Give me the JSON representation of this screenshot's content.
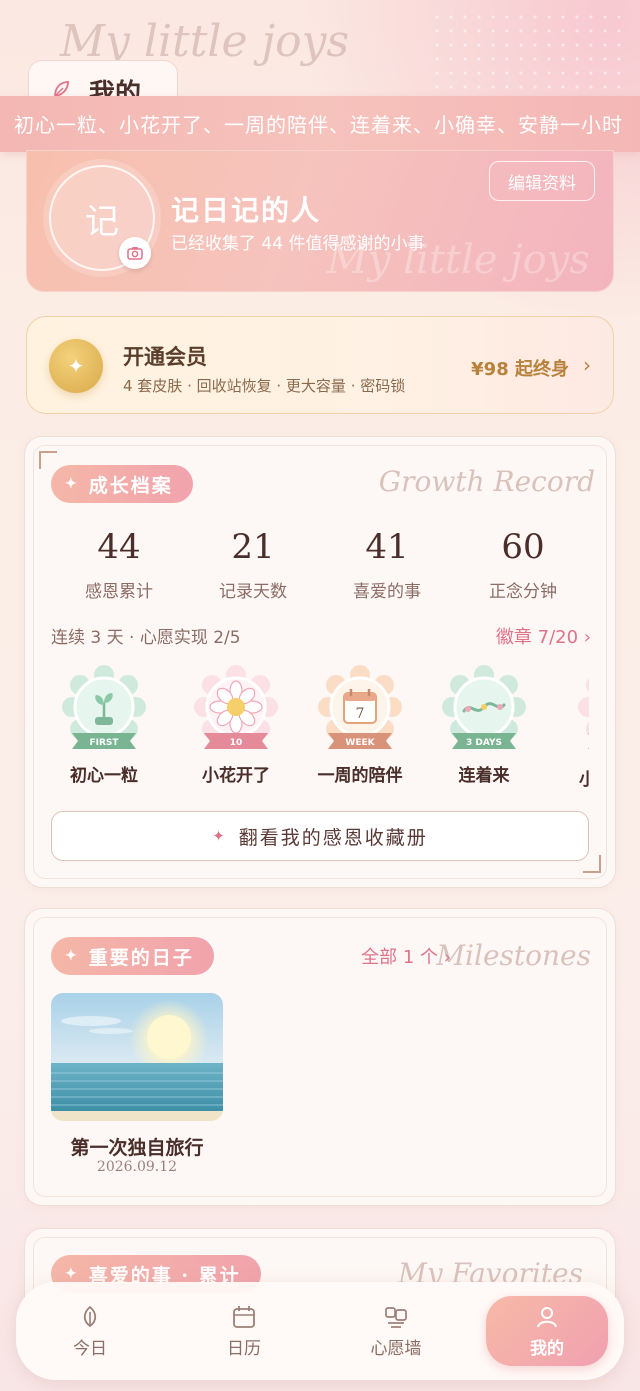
{
  "header": {
    "script": "My little joys",
    "title": "我的"
  },
  "marquee": {
    "text": "初心一粒、小花开了、一周的陪伴、连着来、小确幸、安静一小时"
  },
  "profile": {
    "avatar_char": "记",
    "name": "记日记的人",
    "subtitle": "已经收集了 44 件值得感谢的小事",
    "edit_label": "编辑资料",
    "script": "My little joys"
  },
  "vip": {
    "title": "开通会员",
    "subtitle": "4 套皮肤 · 回收站恢复 · 更大容量 · 密码锁",
    "price": "¥98 起终身"
  },
  "growth": {
    "pill": "成长档案",
    "script": "Growth Record",
    "stats": [
      {
        "value": "44",
        "label": "感恩累计"
      },
      {
        "value": "21",
        "label": "记录天数"
      },
      {
        "value": "41",
        "label": "喜爱的事"
      },
      {
        "value": "60",
        "label": "正念分钟"
      }
    ],
    "streak": "连续 3 天 · 心愿实现 2/5",
    "badges_link": "徽章 7/20",
    "badges": [
      {
        "label": "初心一粒",
        "ribbon": "FIRST"
      },
      {
        "label": "小花开了",
        "ribbon": "10"
      },
      {
        "label": "一周的陪伴",
        "ribbon": "WEEK",
        "day": "7"
      },
      {
        "label": "连着来",
        "ribbon": "3 DAYS"
      },
      {
        "label": "小"
      }
    ],
    "collection_button": "翻看我的感恩收藏册"
  },
  "milestones": {
    "pill": "重要的日子",
    "link": "全部 1 个",
    "script": "Milestones",
    "items": [
      {
        "title": "第一次独自旅行",
        "date": "2026.09.12"
      }
    ]
  },
  "favorites": {
    "pill": "喜爱的事 · 累计",
    "script": "My Favorites"
  },
  "tabbar": {
    "items": [
      {
        "label": "今日",
        "icon": "leaf-icon"
      },
      {
        "label": "日历",
        "icon": "calendar-icon"
      },
      {
        "label": "心愿墙",
        "icon": "wish-wall-icon"
      },
      {
        "label": "我的",
        "icon": "user-icon"
      }
    ]
  },
  "colors": {
    "accent_pink": "#e0738a",
    "pill_gradient_start": "#f5b7a8",
    "gold": "#d9a849"
  }
}
